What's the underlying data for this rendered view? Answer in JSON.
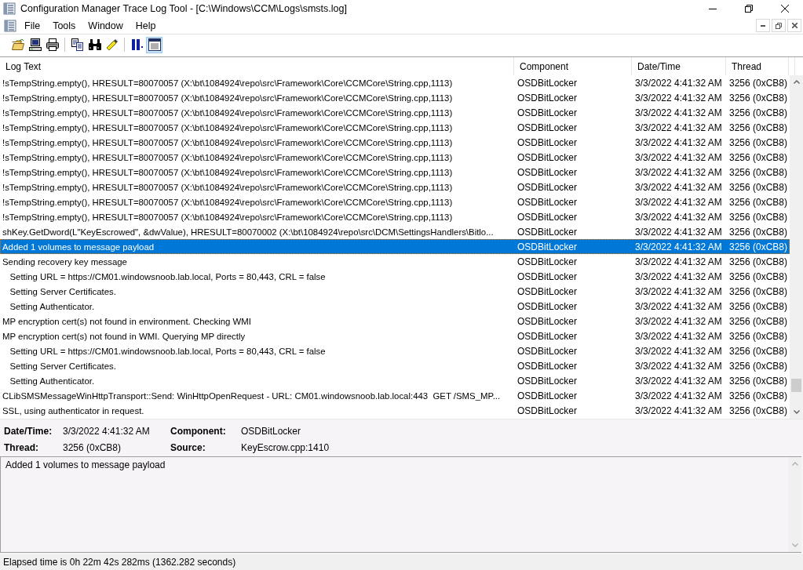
{
  "window": {
    "title": "Configuration Manager Trace Log Tool - [C:\\Windows\\CCM\\Logs\\smsts.log]"
  },
  "menu": [
    "File",
    "Tools",
    "Window",
    "Help"
  ],
  "toolbar": [
    {
      "kind": "open",
      "pressed": false
    },
    {
      "kind": "computer",
      "pressed": false
    },
    {
      "kind": "print",
      "pressed": false
    },
    {
      "kind": "sep"
    },
    {
      "kind": "copy",
      "pressed": false
    },
    {
      "kind": "find",
      "pressed": false
    },
    {
      "kind": "highlight",
      "pressed": false
    },
    {
      "kind": "sep"
    },
    {
      "kind": "pause",
      "pressed": false
    },
    {
      "kind": "details",
      "pressed": true
    }
  ],
  "table": {
    "columns": [
      "Log Text",
      "Component",
      "Date/Time",
      "Thread"
    ],
    "rows": [
      {
        "text": "!sTempString.empty(), HRESULT=80070057 (X:\\bt\\1084924\\repo\\src\\Framework\\Core\\CCMCore\\String.cpp,1113)",
        "component": "OSDBitLocker",
        "datetime": "3/3/2022 4:41:32 AM",
        "thread": "3256 (0xCB8)",
        "selected": false
      },
      {
        "text": "!sTempString.empty(), HRESULT=80070057 (X:\\bt\\1084924\\repo\\src\\Framework\\Core\\CCMCore\\String.cpp,1113)",
        "component": "OSDBitLocker",
        "datetime": "3/3/2022 4:41:32 AM",
        "thread": "3256 (0xCB8)",
        "selected": false
      },
      {
        "text": "!sTempString.empty(), HRESULT=80070057 (X:\\bt\\1084924\\repo\\src\\Framework\\Core\\CCMCore\\String.cpp,1113)",
        "component": "OSDBitLocker",
        "datetime": "3/3/2022 4:41:32 AM",
        "thread": "3256 (0xCB8)",
        "selected": false
      },
      {
        "text": "!sTempString.empty(), HRESULT=80070057 (X:\\bt\\1084924\\repo\\src\\Framework\\Core\\CCMCore\\String.cpp,1113)",
        "component": "OSDBitLocker",
        "datetime": "3/3/2022 4:41:32 AM",
        "thread": "3256 (0xCB8)",
        "selected": false
      },
      {
        "text": "!sTempString.empty(), HRESULT=80070057 (X:\\bt\\1084924\\repo\\src\\Framework\\Core\\CCMCore\\String.cpp,1113)",
        "component": "OSDBitLocker",
        "datetime": "3/3/2022 4:41:32 AM",
        "thread": "3256 (0xCB8)",
        "selected": false
      },
      {
        "text": "!sTempString.empty(), HRESULT=80070057 (X:\\bt\\1084924\\repo\\src\\Framework\\Core\\CCMCore\\String.cpp,1113)",
        "component": "OSDBitLocker",
        "datetime": "3/3/2022 4:41:32 AM",
        "thread": "3256 (0xCB8)",
        "selected": false
      },
      {
        "text": "!sTempString.empty(), HRESULT=80070057 (X:\\bt\\1084924\\repo\\src\\Framework\\Core\\CCMCore\\String.cpp,1113)",
        "component": "OSDBitLocker",
        "datetime": "3/3/2022 4:41:32 AM",
        "thread": "3256 (0xCB8)",
        "selected": false
      },
      {
        "text": "!sTempString.empty(), HRESULT=80070057 (X:\\bt\\1084924\\repo\\src\\Framework\\Core\\CCMCore\\String.cpp,1113)",
        "component": "OSDBitLocker",
        "datetime": "3/3/2022 4:41:32 AM",
        "thread": "3256 (0xCB8)",
        "selected": false
      },
      {
        "text": "!sTempString.empty(), HRESULT=80070057 (X:\\bt\\1084924\\repo\\src\\Framework\\Core\\CCMCore\\String.cpp,1113)",
        "component": "OSDBitLocker",
        "datetime": "3/3/2022 4:41:32 AM",
        "thread": "3256 (0xCB8)",
        "selected": false
      },
      {
        "text": "!sTempString.empty(), HRESULT=80070057 (X:\\bt\\1084924\\repo\\src\\Framework\\Core\\CCMCore\\String.cpp,1113)",
        "component": "OSDBitLocker",
        "datetime": "3/3/2022 4:41:32 AM",
        "thread": "3256 (0xCB8)",
        "selected": false
      },
      {
        "text": "shKey.GetDword(L\"KeyEscrowed\", &dwValue), HRESULT=80070002 (X:\\bt\\1084924\\repo\\src\\DCM\\SettingsHandlers\\Bitlo...",
        "component": "OSDBitLocker",
        "datetime": "3/3/2022 4:41:32 AM",
        "thread": "3256 (0xCB8)",
        "selected": false
      },
      {
        "text": "Added 1 volumes to message payload",
        "component": "OSDBitLocker",
        "datetime": "3/3/2022 4:41:32 AM",
        "thread": "3256 (0xCB8)",
        "selected": true
      },
      {
        "text": "Sending recovery key message",
        "component": "OSDBitLocker",
        "datetime": "3/3/2022 4:41:32 AM",
        "thread": "3256 (0xCB8)",
        "selected": false
      },
      {
        "text": "   Setting URL = https://CM01.windowsnoob.lab.local, Ports = 80,443, CRL = false",
        "component": "OSDBitLocker",
        "datetime": "3/3/2022 4:41:32 AM",
        "thread": "3256 (0xCB8)",
        "selected": false
      },
      {
        "text": "   Setting Server Certificates.",
        "component": "OSDBitLocker",
        "datetime": "3/3/2022 4:41:32 AM",
        "thread": "3256 (0xCB8)",
        "selected": false
      },
      {
        "text": "   Setting Authenticator.",
        "component": "OSDBitLocker",
        "datetime": "3/3/2022 4:41:32 AM",
        "thread": "3256 (0xCB8)",
        "selected": false
      },
      {
        "text": "MP encryption cert(s) not found in environment. Checking WMI",
        "component": "OSDBitLocker",
        "datetime": "3/3/2022 4:41:32 AM",
        "thread": "3256 (0xCB8)",
        "selected": false
      },
      {
        "text": "MP encryption cert(s) not found in WMI. Querying MP directly",
        "component": "OSDBitLocker",
        "datetime": "3/3/2022 4:41:32 AM",
        "thread": "3256 (0xCB8)",
        "selected": false
      },
      {
        "text": "   Setting URL = https://CM01.windowsnoob.lab.local, Ports = 80,443, CRL = false",
        "component": "OSDBitLocker",
        "datetime": "3/3/2022 4:41:32 AM",
        "thread": "3256 (0xCB8)",
        "selected": false
      },
      {
        "text": "   Setting Server Certificates.",
        "component": "OSDBitLocker",
        "datetime": "3/3/2022 4:41:32 AM",
        "thread": "3256 (0xCB8)",
        "selected": false
      },
      {
        "text": "   Setting Authenticator.",
        "component": "OSDBitLocker",
        "datetime": "3/3/2022 4:41:32 AM",
        "thread": "3256 (0xCB8)",
        "selected": false
      },
      {
        "text": "CLibSMSMessageWinHttpTransport::Send: WinHttpOpenRequest - URL: CM01.windowsnoob.lab.local:443  GET /SMS_MP...",
        "component": "OSDBitLocker",
        "datetime": "3/3/2022 4:41:32 AM",
        "thread": "3256 (0xCB8)",
        "selected": false
      },
      {
        "text": "SSL, using authenticator in request.",
        "component": "OSDBitLocker",
        "datetime": "3/3/2022 4:41:32 AM",
        "thread": "3256 (0xCB8)",
        "selected": false
      }
    ]
  },
  "details": {
    "fields": [
      {
        "label": "Date/Time:",
        "value": "3/3/2022 4:41:32 AM"
      },
      {
        "label": "Component:",
        "value": "OSDBitLocker"
      },
      {
        "label": "Thread:",
        "value": "3256 (0xCB8)"
      },
      {
        "label": "Source:",
        "value": "KeyEscrow.cpp:1410"
      }
    ],
    "message": "Added 1 volumes to message payload"
  },
  "status_bar": "Elapsed time is 0h 22m 42s 282ms (1362.282 seconds)"
}
